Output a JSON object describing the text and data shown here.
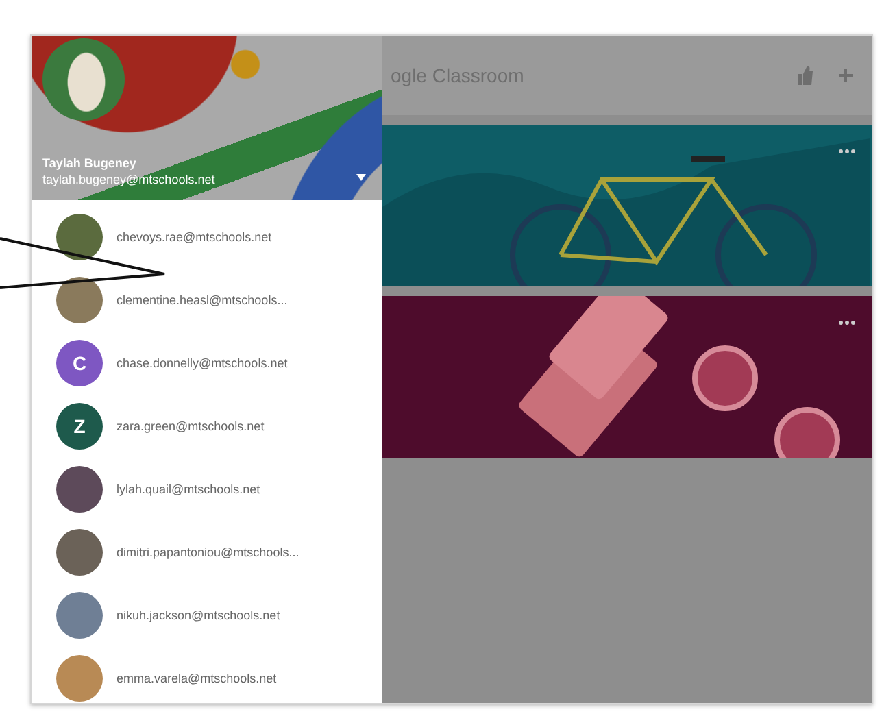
{
  "drawer": {
    "header": {
      "name": "Taylah Bugeney",
      "email": "taylah.bugeney@mtschools.net"
    },
    "accounts": [
      {
        "kind": "photo",
        "email": "chevoys.rae@mtschools.net"
      },
      {
        "kind": "photo",
        "email": "clementine.heasl@mtschools..."
      },
      {
        "kind": "letter",
        "letter": "C",
        "color": "#7e57c2",
        "email": "chase.donnelly@mtschools.net"
      },
      {
        "kind": "letter",
        "letter": "Z",
        "color": "#1e5a4c",
        "email": "zara.green@mtschools.net"
      },
      {
        "kind": "photo",
        "email": "lylah.quail@mtschools.net"
      },
      {
        "kind": "photo",
        "email": "dimitri.papantoniou@mtschools..."
      },
      {
        "kind": "photo",
        "email": "nikuh.jackson@mtschools.net"
      },
      {
        "kind": "photo",
        "email": "emma.varela@mtschools.net"
      }
    ]
  },
  "app_bar": {
    "title": "ogle Classroom"
  },
  "classes": [
    {
      "kind": "bike"
    },
    {
      "kind": "tickets"
    }
  ]
}
